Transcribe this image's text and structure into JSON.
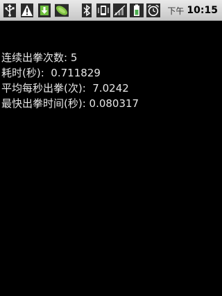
{
  "status_bar": {
    "icons_left": [
      "usb-icon",
      "warning-icon",
      "download-icon",
      "peapod-app-icon"
    ],
    "icons_right": [
      "bluetooth-icon",
      "vibrate-icon",
      "signal-icon",
      "battery-icon",
      "alarm-icon"
    ],
    "clock_period": "下午",
    "clock_time": "10:15"
  },
  "stats": {
    "consecutive_punches": "连续出拳次数: 5",
    "elapsed_seconds": "耗时(秒):  0.711829",
    "avg_punches_per_second": "平均每秒出拳(次):  7.0242",
    "fastest_punch_time": "最快出拳时间(秒): 0.080317"
  },
  "colors": {
    "background": "#000000",
    "text": "#e6e6e6",
    "status_bar": "#d8d8d8"
  }
}
